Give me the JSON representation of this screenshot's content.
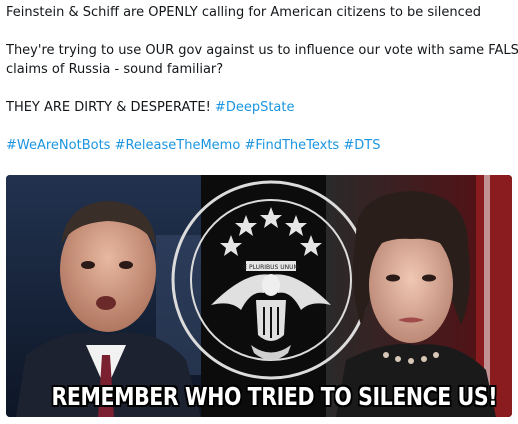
{
  "tweet": {
    "line1": "Feinstein & Schiff are OPENLY calling for American citizens to be silenced",
    "line2": "They're trying to use OUR gov against us to influence our vote with same FALSE",
    "line3": "claims of Russia - sound familiar?",
    "line4_text": "THEY ARE DIRTY & DESPERATE! ",
    "line4_hashtag": "#DeepState",
    "hashtags": [
      "#WeAreNotBots",
      "#ReleaseTheMemo",
      "#FindTheTexts",
      "#DTS"
    ]
  },
  "media": {
    "caption": "REMEMBER WHO TRIED TO SILENCE US!",
    "seal_banner": "E PLURIBUS UNUM",
    "colors": {
      "hashtag": "#1b95e0",
      "caption": "#ffffff",
      "background_left": "#1a2a45",
      "background_right": "#7a1418"
    }
  }
}
